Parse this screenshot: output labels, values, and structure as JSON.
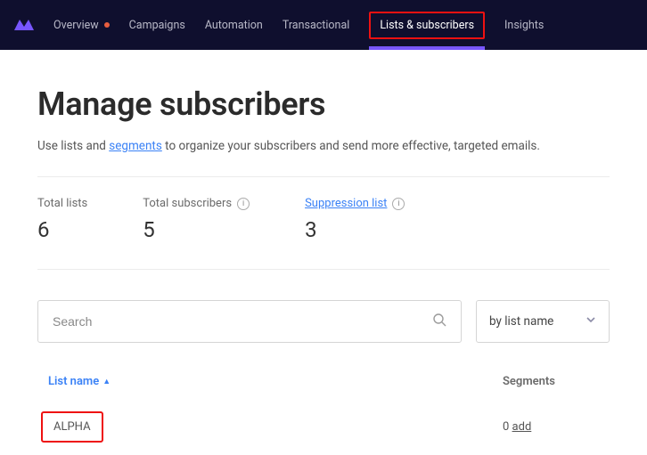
{
  "nav": {
    "items": [
      {
        "label": "Overview",
        "hasDot": true,
        "active": false
      },
      {
        "label": "Campaigns",
        "hasDot": false,
        "active": false
      },
      {
        "label": "Automation",
        "hasDot": false,
        "active": false
      },
      {
        "label": "Transactional",
        "hasDot": false,
        "active": false
      },
      {
        "label": "Lists & subscribers",
        "hasDot": false,
        "active": true
      },
      {
        "label": "Insights",
        "hasDot": false,
        "active": false
      }
    ]
  },
  "page": {
    "title": "Manage subscribers",
    "subtitle_prefix": "Use lists and ",
    "subtitle_link": "segments",
    "subtitle_suffix": " to organize your subscribers and send more effective, targeted emails."
  },
  "stats": {
    "totalLists": {
      "label": "Total lists",
      "value": "6"
    },
    "totalSubs": {
      "label": "Total subscribers",
      "value": "5"
    },
    "suppression": {
      "label": "Suppression list",
      "value": "3"
    }
  },
  "search": {
    "placeholder": "Search"
  },
  "sort": {
    "label": "by list name"
  },
  "table": {
    "col_name": "List name",
    "col_segments": "Segments",
    "rows": [
      {
        "name": "ALPHA",
        "segments_count": "0",
        "add_label": "add"
      }
    ]
  }
}
